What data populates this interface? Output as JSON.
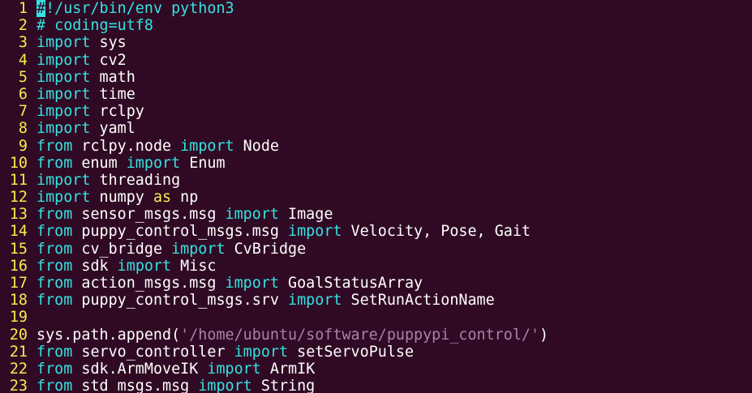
{
  "colors": {
    "background": "#300a24",
    "line_number": "#fce94f",
    "keyword": "#34e2e2",
    "as_keyword": "#fce94f",
    "string": "#ad7fa8",
    "text": "#ffffff"
  },
  "lines": [
    {
      "n": "1",
      "tokens": [
        {
          "t": "#",
          "c": "cursor"
        },
        {
          "t": "!/usr/bin/env python3",
          "c": "cmt"
        }
      ]
    },
    {
      "n": "2",
      "tokens": [
        {
          "t": "# coding=utf8",
          "c": "cmt"
        }
      ]
    },
    {
      "n": "3",
      "tokens": [
        {
          "t": "import",
          "c": "kw"
        },
        {
          "t": " sys",
          "c": ""
        }
      ]
    },
    {
      "n": "4",
      "tokens": [
        {
          "t": "import",
          "c": "kw"
        },
        {
          "t": " cv2",
          "c": ""
        }
      ]
    },
    {
      "n": "5",
      "tokens": [
        {
          "t": "import",
          "c": "kw"
        },
        {
          "t": " math",
          "c": ""
        }
      ]
    },
    {
      "n": "6",
      "tokens": [
        {
          "t": "import",
          "c": "kw"
        },
        {
          "t": " time",
          "c": ""
        }
      ]
    },
    {
      "n": "7",
      "tokens": [
        {
          "t": "import",
          "c": "kw"
        },
        {
          "t": " rclpy",
          "c": ""
        }
      ]
    },
    {
      "n": "8",
      "tokens": [
        {
          "t": "import",
          "c": "kw"
        },
        {
          "t": " yaml",
          "c": ""
        }
      ]
    },
    {
      "n": "9",
      "tokens": [
        {
          "t": "from",
          "c": "kw"
        },
        {
          "t": " rclpy.node ",
          "c": ""
        },
        {
          "t": "import",
          "c": "kw"
        },
        {
          "t": " Node",
          "c": ""
        }
      ]
    },
    {
      "n": "10",
      "tokens": [
        {
          "t": "from",
          "c": "kw"
        },
        {
          "t": " enum ",
          "c": ""
        },
        {
          "t": "import",
          "c": "kw"
        },
        {
          "t": " Enum",
          "c": ""
        }
      ]
    },
    {
      "n": "11",
      "tokens": [
        {
          "t": "import",
          "c": "kw"
        },
        {
          "t": " threading",
          "c": ""
        }
      ]
    },
    {
      "n": "12",
      "tokens": [
        {
          "t": "import",
          "c": "kw"
        },
        {
          "t": " numpy ",
          "c": ""
        },
        {
          "t": "as",
          "c": "as"
        },
        {
          "t": " np",
          "c": ""
        }
      ]
    },
    {
      "n": "13",
      "tokens": [
        {
          "t": "from",
          "c": "kw"
        },
        {
          "t": " sensor_msgs.msg ",
          "c": ""
        },
        {
          "t": "import",
          "c": "kw"
        },
        {
          "t": " Image",
          "c": ""
        }
      ]
    },
    {
      "n": "14",
      "tokens": [
        {
          "t": "from",
          "c": "kw"
        },
        {
          "t": " puppy_control_msgs.msg ",
          "c": ""
        },
        {
          "t": "import",
          "c": "kw"
        },
        {
          "t": " Velocity, Pose, Gait",
          "c": ""
        }
      ]
    },
    {
      "n": "15",
      "tokens": [
        {
          "t": "from",
          "c": "kw"
        },
        {
          "t": " cv_bridge ",
          "c": ""
        },
        {
          "t": "import",
          "c": "kw"
        },
        {
          "t": " CvBridge",
          "c": ""
        }
      ]
    },
    {
      "n": "16",
      "tokens": [
        {
          "t": "from",
          "c": "kw"
        },
        {
          "t": " sdk ",
          "c": ""
        },
        {
          "t": "import",
          "c": "kw"
        },
        {
          "t": " Misc",
          "c": ""
        }
      ]
    },
    {
      "n": "17",
      "tokens": [
        {
          "t": "from",
          "c": "kw"
        },
        {
          "t": " action_msgs.msg ",
          "c": ""
        },
        {
          "t": "import",
          "c": "kw"
        },
        {
          "t": " GoalStatusArray",
          "c": ""
        }
      ]
    },
    {
      "n": "18",
      "tokens": [
        {
          "t": "from",
          "c": "kw"
        },
        {
          "t": " puppy_control_msgs.srv ",
          "c": ""
        },
        {
          "t": "import",
          "c": "kw"
        },
        {
          "t": " SetRunActionName",
          "c": ""
        }
      ]
    },
    {
      "n": "19",
      "tokens": []
    },
    {
      "n": "20",
      "tokens": [
        {
          "t": "sys.path.append(",
          "c": ""
        },
        {
          "t": "'/home/ubuntu/software/puppypi_control/'",
          "c": "str"
        },
        {
          "t": ")",
          "c": ""
        }
      ]
    },
    {
      "n": "21",
      "tokens": [
        {
          "t": "from",
          "c": "kw"
        },
        {
          "t": " servo_controller ",
          "c": ""
        },
        {
          "t": "import",
          "c": "kw"
        },
        {
          "t": " setServoPulse",
          "c": ""
        }
      ]
    },
    {
      "n": "22",
      "tokens": [
        {
          "t": "from",
          "c": "kw"
        },
        {
          "t": " sdk.ArmMoveIK ",
          "c": ""
        },
        {
          "t": "import",
          "c": "kw"
        },
        {
          "t": " ArmIK",
          "c": ""
        }
      ]
    },
    {
      "n": "23",
      "tokens": [
        {
          "t": "from",
          "c": "kw"
        },
        {
          "t": " std_msgs.msg ",
          "c": ""
        },
        {
          "t": "import",
          "c": "kw"
        },
        {
          "t": " String",
          "c": ""
        }
      ]
    }
  ]
}
